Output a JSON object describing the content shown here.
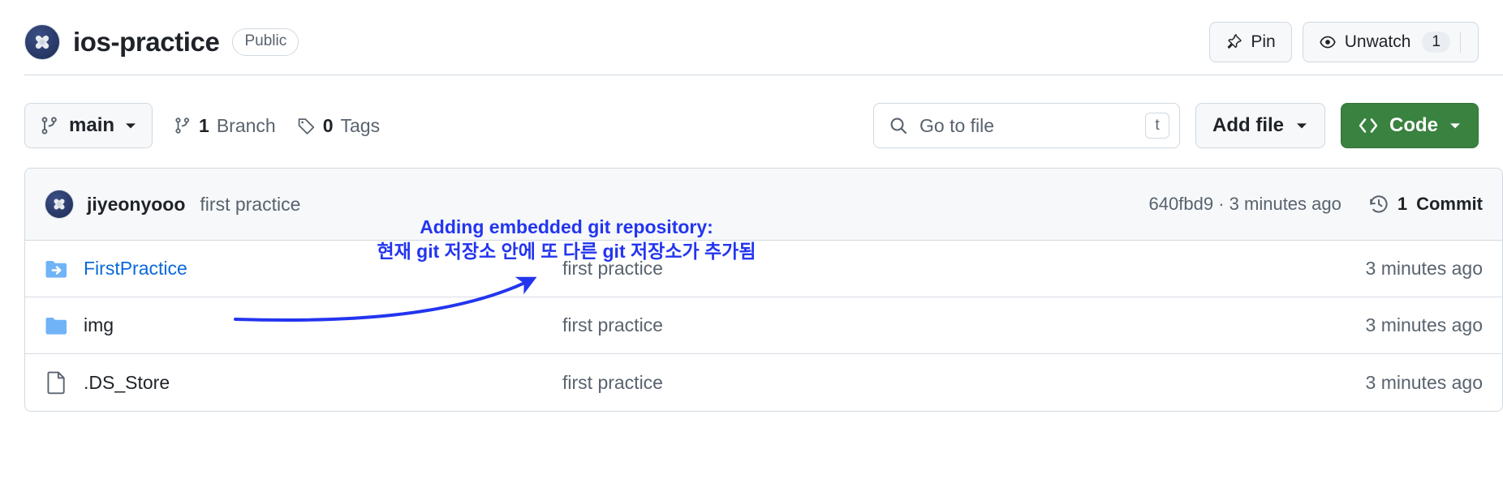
{
  "header": {
    "repo_name": "ios-practice",
    "visibility": "Public",
    "avatar_icon": "repo-owner-avatar",
    "actions": [
      {
        "id": "pin",
        "label": "Pin",
        "icon": "pin-icon",
        "count": null
      },
      {
        "id": "unwatch",
        "label": "Unwatch",
        "icon": "eye-icon",
        "count": "1"
      }
    ]
  },
  "toolbar": {
    "branch": {
      "label": "main",
      "icon": "git-branch-icon",
      "caret": "chevron-down-icon"
    },
    "branch_count": {
      "value": "1",
      "label": "Branch",
      "icon": "git-branch-icon"
    },
    "tag_count": {
      "value": "0",
      "label": "Tags",
      "icon": "tag-icon"
    },
    "search": {
      "placeholder": "Go to file",
      "icon": "search-icon",
      "shortcut": "t"
    },
    "add_file": {
      "label": "Add file",
      "caret": "chevron-down-icon"
    },
    "code": {
      "label": "Code",
      "icon": "code-brackets-icon",
      "caret": "chevron-down-icon",
      "color": "#39823f"
    }
  },
  "commit_bar": {
    "author": "jiyeonyooo",
    "message": "first practice",
    "sha": "640fbd9",
    "separator": "·",
    "relative_time": "3 minutes ago",
    "commit_count": "1",
    "commit_count_label": "Commit",
    "history_icon": "history-clock-icon"
  },
  "files": {
    "columns": [
      "name",
      "message",
      "time"
    ],
    "rows": [
      {
        "name": "FirstPractice",
        "icon": "submodule-folder-icon",
        "is_link": true,
        "message": "first practice",
        "time": "3 minutes ago"
      },
      {
        "name": "img",
        "icon": "folder-icon",
        "is_link": false,
        "message": "first practice",
        "time": "3 minutes ago"
      },
      {
        "name": ".DS_Store",
        "icon": "file-icon",
        "is_link": false,
        "message": "first practice",
        "time": "3 minutes ago"
      }
    ]
  },
  "annotation": {
    "line1": "Adding embedded git repository:",
    "line2": "현재 git 저장소 안에 또 다른 git 저장소가 추가됨",
    "color": "#2335ef",
    "arrow": "curved-arrow-pointing-up-right"
  }
}
